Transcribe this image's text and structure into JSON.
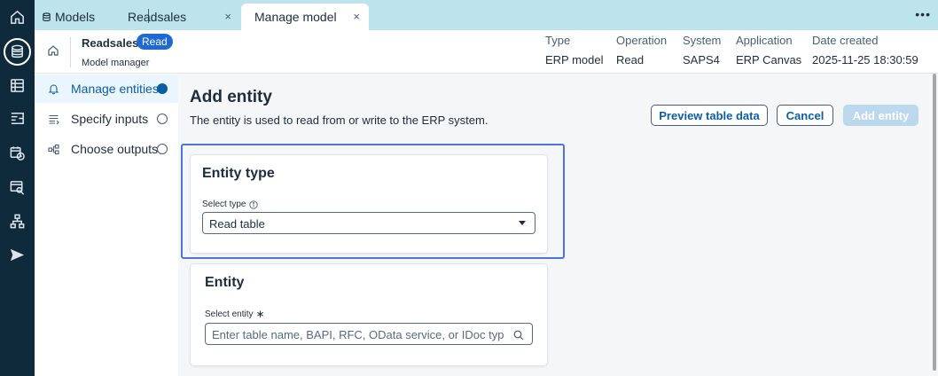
{
  "tabs": [
    {
      "label": "Models",
      "icon": "database-icon"
    },
    {
      "label": "Readsales",
      "close": "×"
    },
    {
      "label": "Manage model",
      "close": "×",
      "active": true
    }
  ],
  "tab_more": "•••",
  "rail": {
    "items": [
      "home-icon",
      "database-icon",
      "table-icon",
      "data-flow-icon",
      "calendar-clock-icon",
      "table-search-icon",
      "hierarchy-icon",
      "send-icon"
    ],
    "active": "database-icon"
  },
  "header": {
    "model_name": "Readsales",
    "mode_badge": "Read",
    "subtitle": "Model manager",
    "meta": [
      {
        "label": "Type",
        "value": "ERP model"
      },
      {
        "label": "Operation",
        "value": "Read"
      },
      {
        "label": "System",
        "value": "SAPS4"
      },
      {
        "label": "Application",
        "value": "ERP Canvas"
      },
      {
        "label": "Date created",
        "value": "2025-11-25 18:30:59"
      }
    ]
  },
  "sidenav": {
    "items": [
      {
        "label": "Manage entities",
        "icon": "bell-icon",
        "active": true
      },
      {
        "label": "Specify inputs",
        "icon": "list-input-icon"
      },
      {
        "label": "Choose outputs",
        "icon": "tree-output-icon"
      }
    ]
  },
  "main": {
    "title": "Add entity",
    "description": "The entity is used to read from or write to the ERP system.",
    "buttons": {
      "preview": "Preview table data",
      "cancel": "Cancel",
      "add": "Add entity"
    },
    "entity_type_card": {
      "title": "Entity type",
      "select_label": "Select type",
      "select_value": "Read table"
    },
    "entity_card": {
      "title": "Entity",
      "select_label": "Select entity",
      "required_mark": "∗",
      "search_placeholder": "Enter table name, BAPI, RFC, OData service, or IDoc type..."
    }
  },
  "colors": {
    "rail_bg": "#0f2a3a",
    "tabstrip_bg": "#bde3ec",
    "accent": "#0b5ea6",
    "badge": "#1e6ad5",
    "focus": "#4f73e0",
    "disabled_button": "#bcd8ec"
  }
}
